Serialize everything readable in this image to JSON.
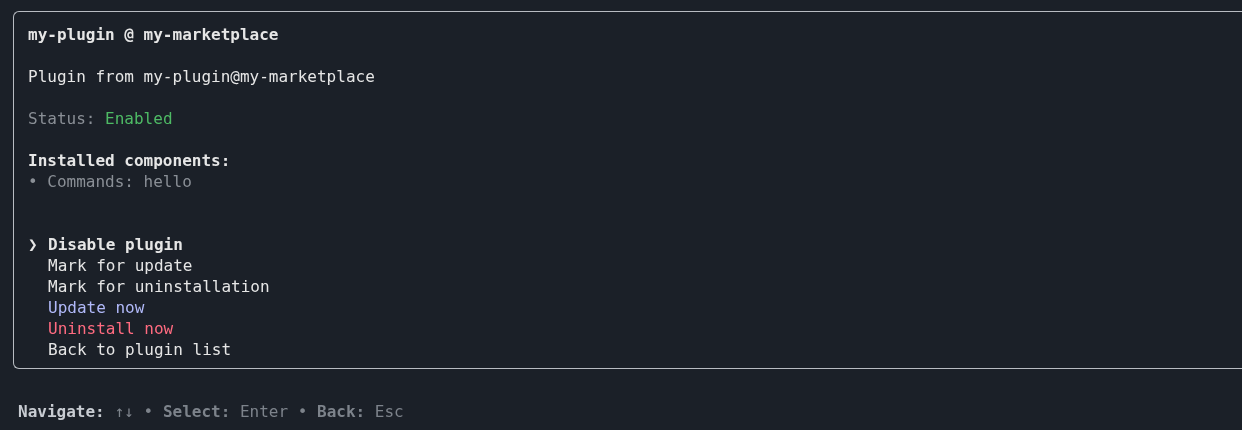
{
  "title": "my-plugin @ my-marketplace",
  "source": "Plugin from my-plugin@my-marketplace",
  "status": {
    "label": "Status:",
    "value": "Enabled",
    "color": "#4eba65"
  },
  "components": {
    "heading": "Installed components:",
    "items": [
      "• Commands: hello"
    ]
  },
  "pointer": "❯",
  "menu": [
    {
      "label": "Disable plugin",
      "selected": true,
      "color": "#e6e6e6"
    },
    {
      "label": "Mark for update",
      "selected": false,
      "color": "#e6e6e6"
    },
    {
      "label": "Mark for uninstallation",
      "selected": false,
      "color": "#e6e6e6"
    },
    {
      "label": "Update now",
      "selected": false,
      "color": "#b1b9f9"
    },
    {
      "label": "Uninstall now",
      "selected": false,
      "color": "#ff6b80"
    },
    {
      "label": "Back to plugin list",
      "selected": false,
      "color": "#e6e6e6"
    }
  ],
  "footer": {
    "label": "Navigate:",
    "hints": "↑↓ • **Select:** Enter • **Back:** Esc"
  }
}
